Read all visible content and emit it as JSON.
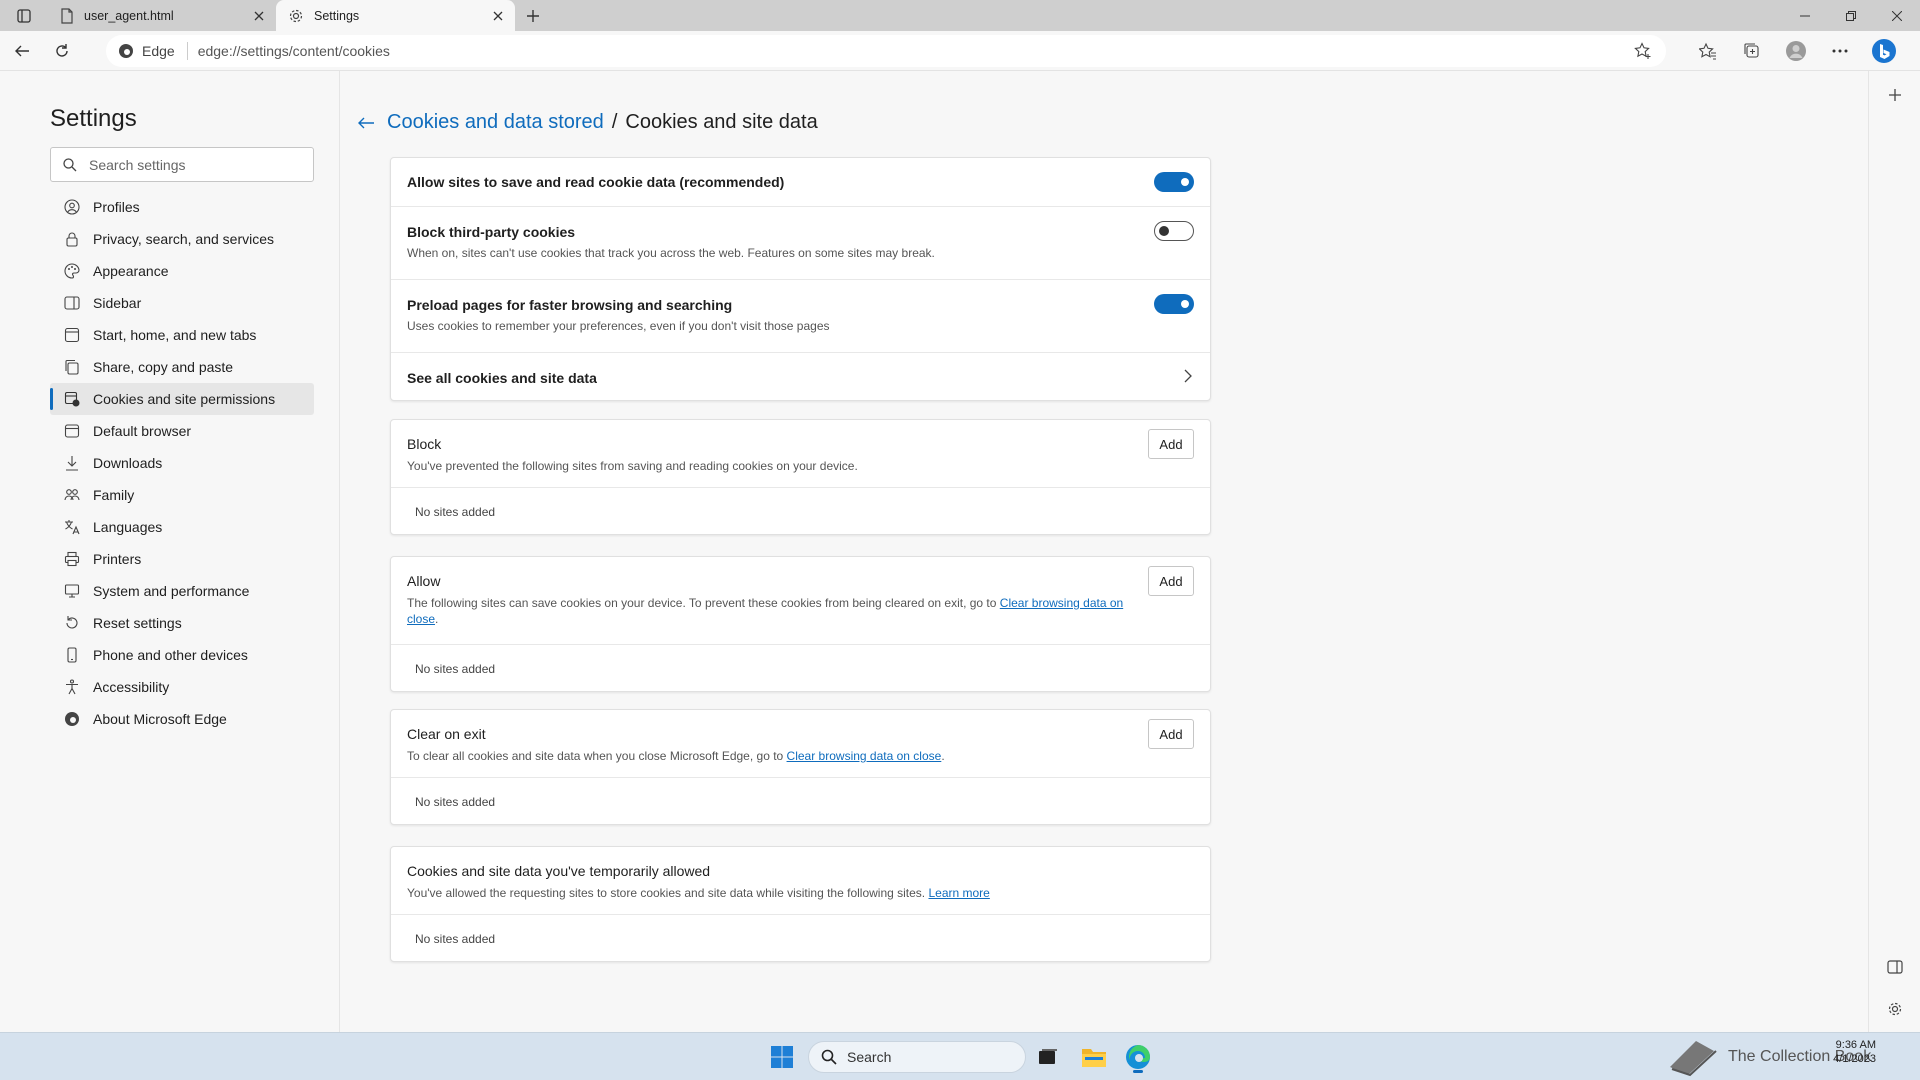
{
  "tabs": [
    {
      "label": "user_agent.html",
      "icon": "file-icon"
    },
    {
      "label": "Settings",
      "icon": "gear-icon",
      "active": true
    }
  ],
  "address_bar": {
    "badge": "Edge",
    "url": "edge://settings/content/cookies"
  },
  "settings_nav": {
    "title": "Settings",
    "search_placeholder": "Search settings",
    "items": [
      {
        "label": "Profiles",
        "icon": "profile-icon"
      },
      {
        "label": "Privacy, search, and services",
        "icon": "lock-icon"
      },
      {
        "label": "Appearance",
        "icon": "appearance-icon"
      },
      {
        "label": "Sidebar",
        "icon": "sidebar-icon"
      },
      {
        "label": "Start, home, and new tabs",
        "icon": "home-icon"
      },
      {
        "label": "Share, copy and paste",
        "icon": "share-icon"
      },
      {
        "label": "Cookies and site permissions",
        "icon": "cookies-icon",
        "active": true
      },
      {
        "label": "Default browser",
        "icon": "browser-icon"
      },
      {
        "label": "Downloads",
        "icon": "download-icon"
      },
      {
        "label": "Family",
        "icon": "family-icon"
      },
      {
        "label": "Languages",
        "icon": "language-icon"
      },
      {
        "label": "Printers",
        "icon": "printer-icon"
      },
      {
        "label": "System and performance",
        "icon": "system-icon"
      },
      {
        "label": "Reset settings",
        "icon": "reset-icon"
      },
      {
        "label": "Phone and other devices",
        "icon": "phone-icon"
      },
      {
        "label": "Accessibility",
        "icon": "accessibility-icon"
      },
      {
        "label": "About Microsoft Edge",
        "icon": "edge-logo-icon"
      }
    ]
  },
  "breadcrumb": {
    "parent": "Cookies and data stored",
    "separator": "/",
    "current": "Cookies and site data"
  },
  "main_settings": [
    {
      "title": "Allow sites to save and read cookie data (recommended)",
      "description": "",
      "toggle": true
    },
    {
      "title": "Block third-party cookies",
      "description": "When on, sites can't use cookies that track you across the web. Features on some sites may break.",
      "toggle": false
    },
    {
      "title": "Preload pages for faster browsing and searching",
      "description": "Uses cookies to remember your preferences, even if you don't visit those pages",
      "toggle": true
    },
    {
      "title": "See all cookies and site data"
    }
  ],
  "sections": {
    "block": {
      "title": "Block",
      "description": "You've prevented the following sites from saving and reading cookies on your device.",
      "add_label": "Add",
      "empty": "No sites added"
    },
    "allow": {
      "title": "Allow",
      "description": "The following sites can save cookies on your device. To prevent these cookies from being cleared on exit, go to ",
      "link": "Clear browsing data on close",
      "description_end": ".",
      "add_label": "Add",
      "empty": "No sites added"
    },
    "clear_on_exit": {
      "title": "Clear on exit",
      "description": "To clear all cookies and site data when you close Microsoft Edge, go to ",
      "link": "Clear browsing data on close",
      "description_end": ".",
      "add_label": "Add",
      "empty": "No sites added"
    },
    "temp_allowed": {
      "title": "Cookies and site data you've temporarily allowed",
      "description": "You've allowed the requesting sites to store cookies and site data while visiting the following sites. ",
      "link": "Learn more",
      "empty": "No sites added"
    }
  },
  "taskbar": {
    "search_label": "Search",
    "tray_text": "The Collection Book",
    "time": "9:36 AM",
    "date": "4/1/2023"
  },
  "colors": {
    "accent": "#0f6cbd",
    "taskbar": "#d6e2ee"
  }
}
